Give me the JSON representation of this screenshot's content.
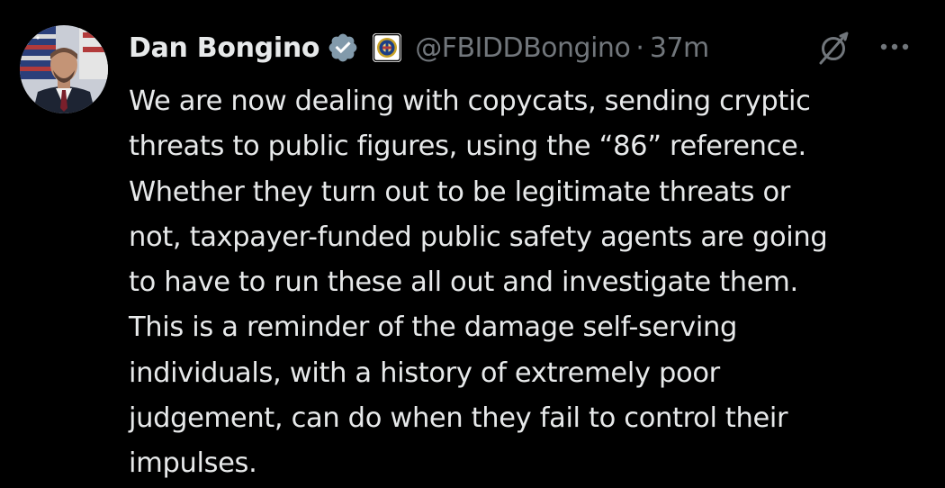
{
  "author": {
    "name": "Dan Bongino",
    "handle": "@FBIDDBongino",
    "separator": "·",
    "time": "37m",
    "verified_color": "#829aab",
    "avatar_icon": "profile-photo",
    "affiliate_icon": "fbi-seal-icon"
  },
  "actions": {
    "grok_icon": "grok-icon",
    "more_icon": "more-options-icon"
  },
  "tweet": {
    "text": "We are now dealing with copycats, sending cryptic\nthreats to public figures, using the “86” reference.\nWhether they turn out to be legitimate threats or\nnot, taxpayer-funded public safety agents are going\nto have to run these all out and investigate them.\nThis is a reminder of the damage self-serving\nindividuals, with a history of extremely poor\njudgement, can do when they fail to control their\nimpulses."
  },
  "colors": {
    "background": "#000000",
    "primary_text": "#e7e9ea",
    "secondary_text": "#71767b"
  }
}
